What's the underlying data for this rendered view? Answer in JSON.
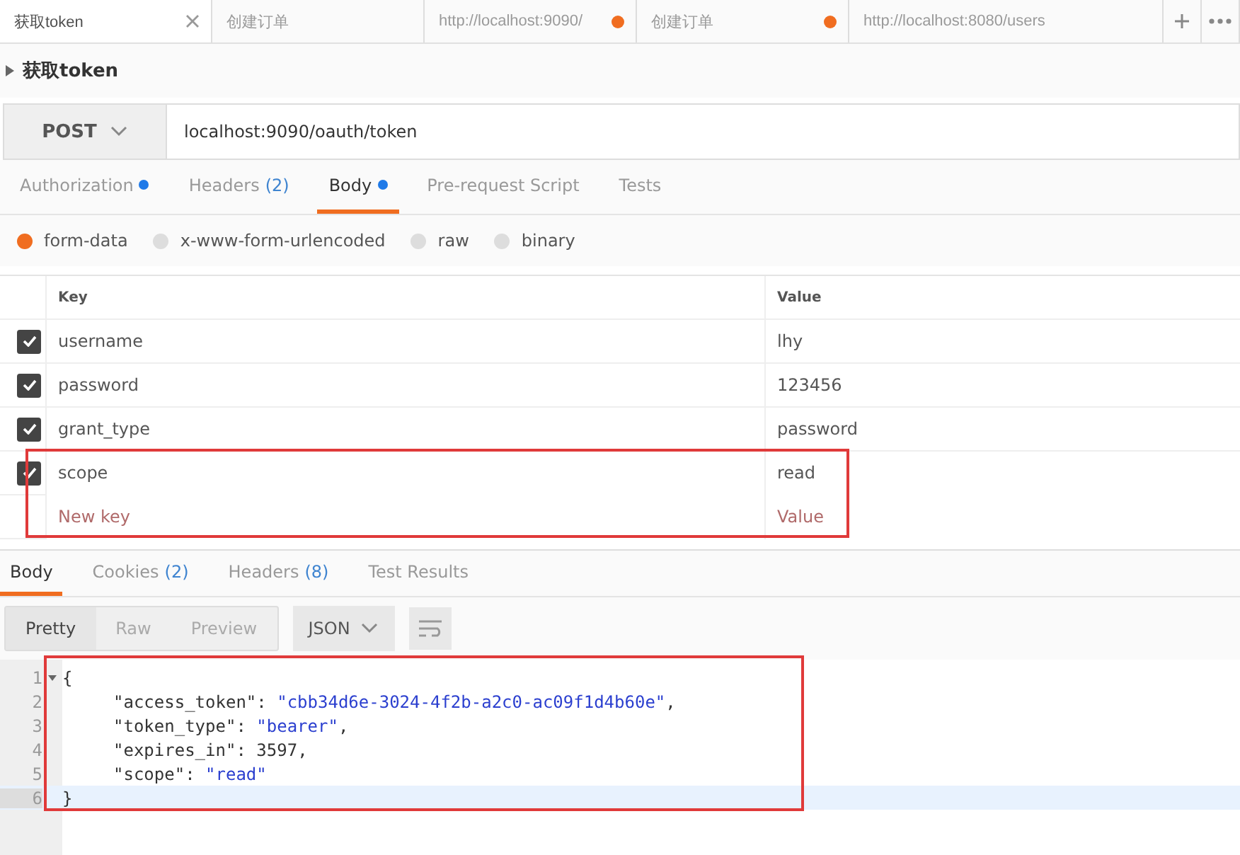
{
  "tabs": [
    {
      "label": "获取token",
      "selected": true,
      "unsaved": false,
      "closable": true
    },
    {
      "label": "创建订单",
      "selected": false,
      "unsaved": false,
      "closable": false
    },
    {
      "label": "http://localhost:9090/",
      "selected": false,
      "unsaved": true,
      "closable": false
    },
    {
      "label": "创建订单",
      "selected": false,
      "unsaved": true,
      "closable": false
    },
    {
      "label": "http://localhost:8080/users",
      "selected": false,
      "unsaved": false,
      "closable": false
    }
  ],
  "request": {
    "name": "获取token",
    "method": "POST",
    "url": "localhost:9090/oauth/token"
  },
  "request_tabs": [
    {
      "label": "Authorization",
      "dot": true,
      "selected": false
    },
    {
      "label": "Headers",
      "count": "(2)",
      "dot": false,
      "selected": false
    },
    {
      "label": "Body",
      "dot": true,
      "selected": true
    },
    {
      "label": "Pre-request Script",
      "dot": false,
      "selected": false
    },
    {
      "label": "Tests",
      "dot": false,
      "selected": false
    }
  ],
  "body_types": [
    {
      "label": "form-data",
      "selected": true
    },
    {
      "label": "x-www-form-urlencoded",
      "selected": false
    },
    {
      "label": "raw",
      "selected": false
    },
    {
      "label": "binary",
      "selected": false
    }
  ],
  "params": {
    "columns": [
      "Key",
      "Value"
    ],
    "rows": [
      {
        "key": "username",
        "value": "lhy",
        "checked": true,
        "annotated": false
      },
      {
        "key": "password",
        "value": "123456",
        "checked": true,
        "annotated": false
      },
      {
        "key": "grant_type",
        "value": "password",
        "checked": true,
        "annotated": false
      },
      {
        "key": "scope",
        "value": "read",
        "checked": true,
        "annotated": true
      }
    ],
    "new_row": {
      "key_placeholder": "New key",
      "value_placeholder": "Value"
    }
  },
  "response_tabs": [
    {
      "label": "Body",
      "selected": true
    },
    {
      "label": "Cookies",
      "count": "(2)",
      "selected": false
    },
    {
      "label": "Headers",
      "count": "(8)",
      "selected": false
    },
    {
      "label": "Test Results",
      "selected": false
    }
  ],
  "view_modes": [
    {
      "label": "Pretty",
      "selected": true
    },
    {
      "label": "Raw",
      "selected": false
    },
    {
      "label": "Preview",
      "selected": false
    }
  ],
  "format": "JSON",
  "response_body": {
    "annotated": true,
    "lines": [
      {
        "number": "1",
        "indented": false,
        "current": false,
        "parts": [
          {
            "kind": "punct",
            "text": "{"
          }
        ]
      },
      {
        "number": "2",
        "indented": true,
        "current": false,
        "parts": [
          {
            "kind": "key",
            "text": "\"access_token\""
          },
          {
            "kind": "punct",
            "text": ": "
          },
          {
            "kind": "string",
            "text": "\"cbb34d6e-3024-4f2b-a2c0-ac09f1d4b60e\""
          },
          {
            "kind": "punct",
            "text": ","
          }
        ]
      },
      {
        "number": "3",
        "indented": true,
        "current": false,
        "parts": [
          {
            "kind": "key",
            "text": "\"token_type\""
          },
          {
            "kind": "punct",
            "text": ": "
          },
          {
            "kind": "string",
            "text": "\"bearer\""
          },
          {
            "kind": "punct",
            "text": ","
          }
        ]
      },
      {
        "number": "4",
        "indented": true,
        "current": false,
        "parts": [
          {
            "kind": "key",
            "text": "\"expires_in\""
          },
          {
            "kind": "punct",
            "text": ": "
          },
          {
            "kind": "number",
            "text": "3597"
          },
          {
            "kind": "punct",
            "text": ","
          }
        ]
      },
      {
        "number": "5",
        "indented": true,
        "current": false,
        "parts": [
          {
            "kind": "key",
            "text": "\"scope\""
          },
          {
            "kind": "punct",
            "text": ": "
          },
          {
            "kind": "string",
            "text": "\"read\""
          }
        ]
      },
      {
        "number": "6",
        "indented": false,
        "current": true,
        "parts": [
          {
            "kind": "punct",
            "text": "}"
          }
        ]
      }
    ]
  }
}
